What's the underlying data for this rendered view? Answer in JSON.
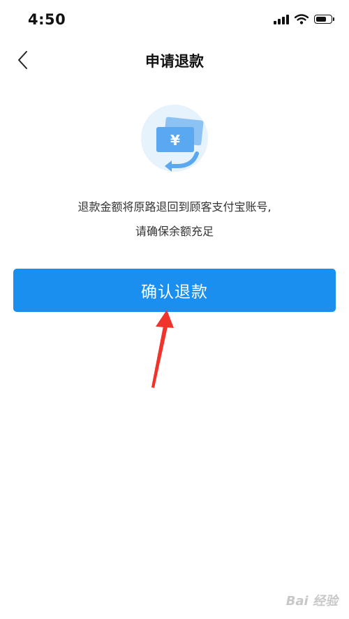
{
  "status_bar": {
    "time": "4:50",
    "battery_level": 0.75
  },
  "nav": {
    "back_icon": "chevron-left-icon",
    "title": "申请退款"
  },
  "illustration": {
    "icon": "refund-money-icon",
    "currency_symbol": "¥",
    "colors": {
      "circle": "#e6f2fc",
      "bill": "#5aa8f0",
      "bill_back": "#8cc3f4",
      "arrow": "#5aa8f0"
    }
  },
  "description": {
    "line1": "退款金额将原路退回到顾客支付宝账号,",
    "line2": "请确保余额充足"
  },
  "confirm_button": {
    "label": "确认退款",
    "color": "#1a8ff0"
  },
  "annotation": {
    "arrow_color": "#f0342c"
  },
  "watermark": {
    "text": "Bai 经验"
  }
}
